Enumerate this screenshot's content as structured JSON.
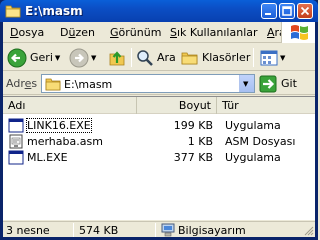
{
  "window": {
    "title": "E:\\masm"
  },
  "menu": [
    {
      "pre": "",
      "u": "D",
      "post": "osya"
    },
    {
      "pre": "D",
      "u": "ü",
      "post": "zen"
    },
    {
      "pre": "",
      "u": "G",
      "post": "örünüm"
    },
    {
      "pre": "",
      "u": "S",
      "post": "ık Kullanılanlar"
    },
    {
      "pre": "",
      "u": "A",
      "post": "raçlar"
    }
  ],
  "toolbar": {
    "back_label": "Geri",
    "search_label": "Ara",
    "folders_label": "Klasörler"
  },
  "address": {
    "label_pre": "Adr",
    "label_u": "e",
    "label_post": "s",
    "value": "E:\\masm",
    "go_label": "Git"
  },
  "columns": {
    "name": "Adı",
    "size": "Boyut",
    "type": "Tür"
  },
  "files": [
    {
      "name": "LINK16.EXE",
      "size": "199 KB",
      "type": "Uygulama",
      "icon": "exe-icon"
    },
    {
      "name": "merhaba.asm",
      "size": "1 KB",
      "type": "ASM Dosyası",
      "icon": "asm-file-icon"
    },
    {
      "name": "ML.EXE",
      "size": "377 KB",
      "type": "Uygulama",
      "icon": "exe-icon"
    }
  ],
  "status": {
    "count": "3 nesne",
    "total": "574 KB",
    "location": "Bilgisayarım"
  }
}
